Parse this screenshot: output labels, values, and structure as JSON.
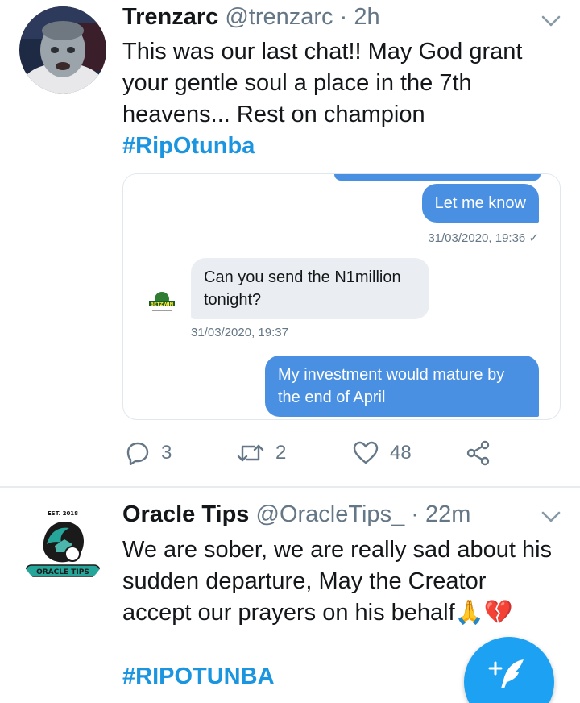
{
  "tweets": [
    {
      "name": "Trenzarc",
      "handle": "@trenzarc · 2h",
      "text_lines": [
        "This was our last chat!! May God grant",
        "your gentle soul a place in the 7th",
        "heavens... Rest on champion"
      ],
      "hashtag": "#RipOtunba",
      "media": {
        "out_message_1": "Let me know",
        "out_timestamp_1": "31/03/2020, 19:36 ✓",
        "in_message": "Can you send the N1million tonight?",
        "in_timestamp": "31/03/2020, 19:37",
        "out_message_2": "My investment would mature by the end of April",
        "chat_avatar_text": "BETZWIN"
      },
      "actions": {
        "replies": "3",
        "retweets": "2",
        "likes": "48"
      },
      "icons": [
        "reply-icon",
        "retweet-icon",
        "like-icon",
        "share-icon",
        "chevron-down-icon"
      ]
    },
    {
      "name": "Oracle Tips",
      "handle": "@OracleTips_ · 22m",
      "text_lines": [
        "We are sober, we are really sad about his",
        "sudden departure, May the Creator",
        "accept our prayers on his behalf🙏💔"
      ],
      "hashtag": "#RIPOTUNBA",
      "avatar_texts": {
        "top": "EST. 2018",
        "brand": "ORACLE TIPS"
      }
    }
  ],
  "colors": {
    "link": "#1b95e0",
    "bubble_out": "#4a90e2",
    "bubble_in": "#eaeef2",
    "muted": "#657786",
    "fab": "#1da1f2"
  }
}
